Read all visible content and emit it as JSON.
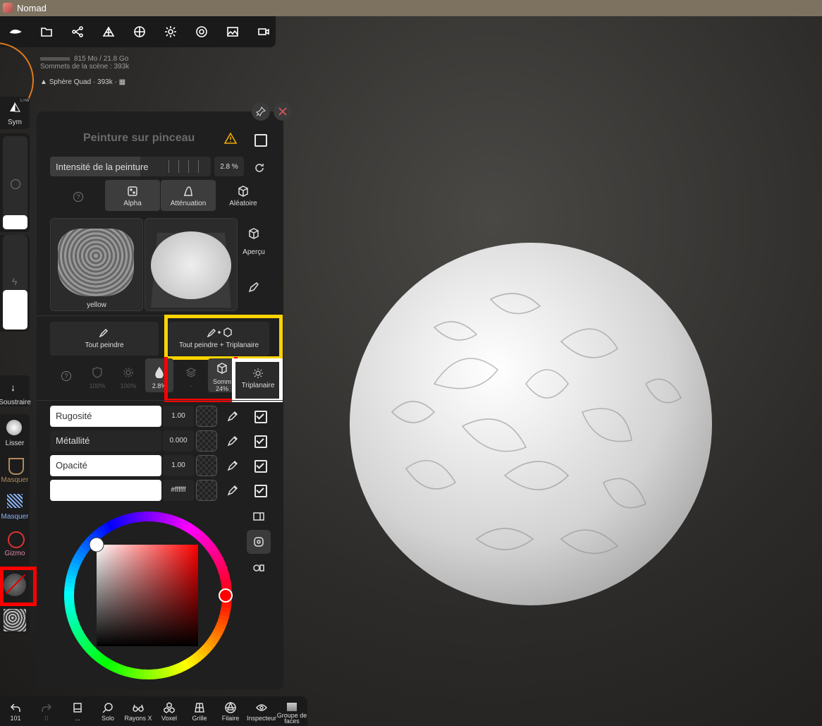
{
  "app": {
    "title": "Nomad"
  },
  "toolbar": {
    "icons": [
      "logo-icon",
      "folder-icon",
      "scene-graph-icon",
      "mesh-icon",
      "material-icon",
      "light-icon",
      "render-icon",
      "background-icon",
      "camera-icon"
    ]
  },
  "stats": {
    "memory": "815 Mo / 21.8 Go",
    "vertices_label": "Sommets de la scène :",
    "vertices_value": "393k",
    "mesh": "Sphère Quad · 393k ·"
  },
  "left": {
    "sym": "Sym",
    "sym_badge": "L>W",
    "soustraire": "Soustraire",
    "lisser": "Lisser",
    "masquer1": "Masquer",
    "masquer2": "Masquer",
    "gizmo": "Gizmo"
  },
  "panel": {
    "title": "Peinture sur pinceau",
    "intensity_label": "Intensité de la peinture",
    "intensity_value": "2.8 %",
    "intensity_fraction": 0.028,
    "tabs": {
      "alpha": "Alpha",
      "attenuation": "Atténuation",
      "aleatoire": "Aléatoire"
    },
    "alpha_name": "yellow",
    "apercu": "Aperçu",
    "tout_peindre": "Tout peindre",
    "tout_peindre_tri": "Tout peindre + Triplanaire",
    "mini": {
      "m1": "100%",
      "m2": "100%",
      "m3": "2.8%",
      "m4": "-",
      "m5a": "Somm",
      "m5b": "24%",
      "tri": "Triplanaire"
    },
    "props": [
      {
        "name": "Rugosité",
        "value": "1.00",
        "checked": true
      },
      {
        "name": "Métallité",
        "value": "0.000",
        "checked": true
      },
      {
        "name": "Opacité",
        "value": "1.00",
        "checked": true
      },
      {
        "name": "",
        "value": "#ffffff",
        "checked": true
      }
    ]
  },
  "colors": {
    "accent_red": "#ff0000",
    "highlight_yellow": "#ffd400",
    "highlight_white": "#ffffff",
    "picked": "#ff0000"
  },
  "bottom": {
    "undo": "101",
    "redo": "0",
    "menu": "...",
    "solo": "Solo",
    "rayons": "Rayons X",
    "voxel": "Voxel",
    "grille": "Grille",
    "filaire": "Filaire",
    "inspecteur": "Inspecteur",
    "groupe": "Groupe de faces"
  }
}
